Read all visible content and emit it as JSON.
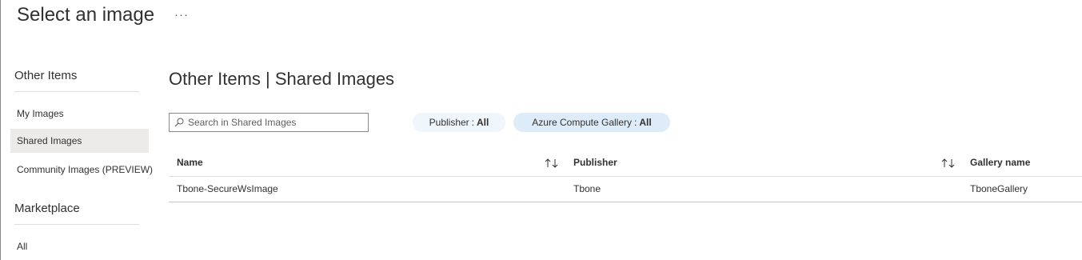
{
  "blade": {
    "title": "Select an image",
    "more_label": "···"
  },
  "sidebar": {
    "sections": [
      {
        "title": "Other Items",
        "items": [
          {
            "label": "My Images",
            "selected": false
          },
          {
            "label": "Shared Images",
            "selected": true
          },
          {
            "label": "Community Images (PREVIEW)",
            "selected": false
          }
        ]
      },
      {
        "title": "Marketplace",
        "items": [
          {
            "label": "All",
            "selected": false
          }
        ]
      }
    ]
  },
  "main": {
    "title": "Other Items | Shared Images",
    "search": {
      "placeholder": "Search in Shared Images",
      "value": ""
    },
    "filters": [
      {
        "label": "Publisher",
        "value": "All",
        "color": "#eff6fc"
      },
      {
        "label": "Azure Compute Gallery",
        "value": "All",
        "color": "#deecf9"
      }
    ],
    "table": {
      "columns": [
        "Name",
        "Publisher",
        "Gallery name"
      ],
      "rows": [
        [
          "Tbone-SecureWsImage",
          "Tbone",
          "TboneGallery"
        ]
      ]
    }
  }
}
